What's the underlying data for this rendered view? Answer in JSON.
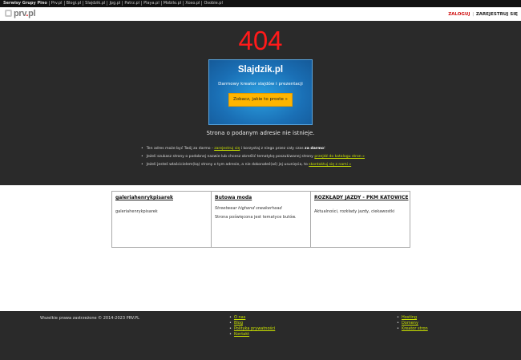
{
  "network_bar": {
    "label": "Serwisy Grupy Pino",
    "links": [
      "Prv.pl",
      "Blogi.pl",
      "Slajdzik.pl",
      "Jpg.pl",
      "Patrz.pl",
      "Playa.pl",
      "Mobilo.pl",
      "Xoxo.pl",
      "Osobie.pl"
    ]
  },
  "header": {
    "logo_main": "prv",
    "logo_dot": ".",
    "logo_tld": "pl",
    "login": "ZALOGUJ",
    "separator": "|",
    "register": "ZAREJESTRUJ SIĘ"
  },
  "error": {
    "code": "404"
  },
  "promo": {
    "title": "Slajdzik.pl",
    "subtitle": "Darmowy kreator slajdów i prezentacji",
    "button": "Zobacz, jakie to proste »"
  },
  "message": "Strona o podanym adresie nie istnieje.",
  "tips": [
    {
      "before": "Ten adres może być Twój za darmo - ",
      "link": "zarejestruj się",
      "after": " i korzystaj z niego przez cały czas ",
      "bold": "za darmo",
      "end": "!"
    },
    {
      "before": "Jeżeli szukasz strony o podobnej nazwie lub chcesz określić tematykę poszukiwanej strony ",
      "link": "przejdź do katalogu stron »",
      "after": "",
      "bold": "",
      "end": ""
    },
    {
      "before": "Jeżeli jesteś właścicielem(ką) strony o tym adresie, a nie dokonałeś(aś) jej usunięcia, to ",
      "link": "skontaktuj się z nami »",
      "after": "",
      "bold": "",
      "end": ""
    }
  ],
  "cards": [
    {
      "title": "galeriahenrykpisarek",
      "tagline": "",
      "desc": "galeriahenrykpisarek"
    },
    {
      "title": "Butowa moda",
      "tagline": "Streetwear highend sneakerhead",
      "desc": "Strona poświęcona jest tematyce butów."
    },
    {
      "title": "ROZKŁADY JAZDY - PKM KATOWICE",
      "tagline": "",
      "desc": "Aktualności, rozkłady jazdy, ciekawostki"
    }
  ],
  "footer": {
    "copyright": "Wszelkie prawa zastrzeżone © 2014-2023 PRV.PL",
    "links_col1": [
      "O nas",
      "Blog",
      "Polityka prywatności",
      "Kontakt"
    ],
    "links_col2": [
      "Hosting",
      "Domeny",
      "Kreator stron"
    ]
  },
  "colors": {
    "error_red": "#ff1a1a",
    "link_lime": "#c8e000",
    "promo_blue": "#1a6fb5",
    "button_orange": "#ffb500",
    "dark_bg": "#2a2a2a"
  }
}
